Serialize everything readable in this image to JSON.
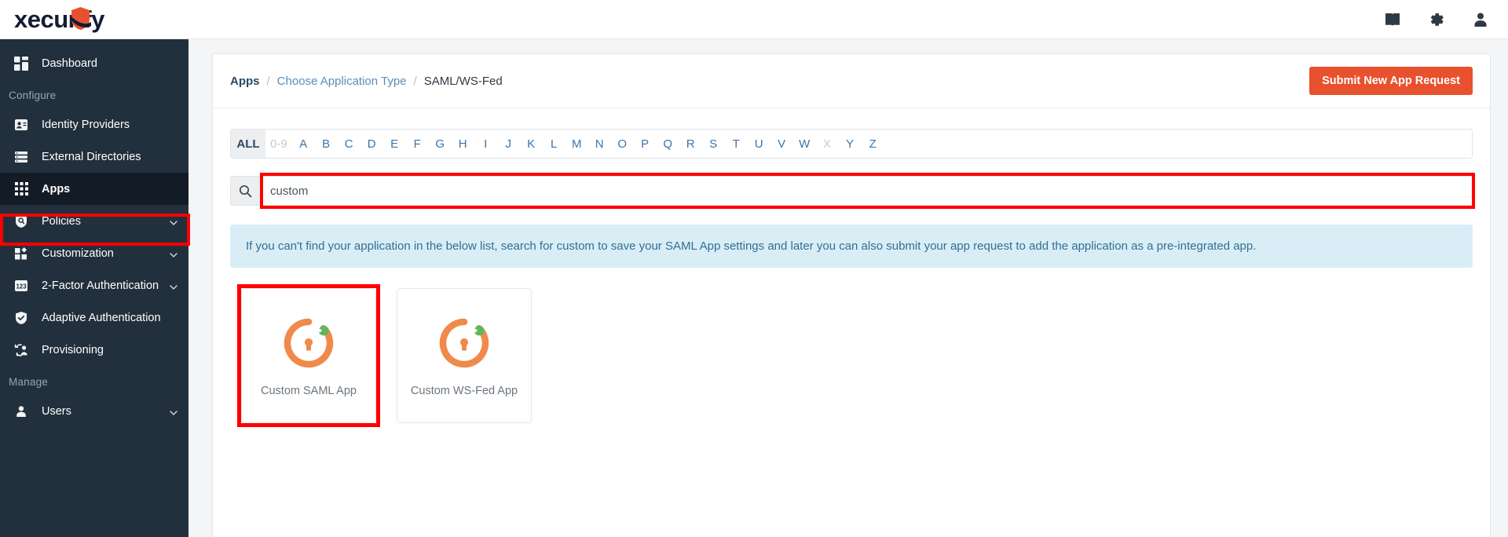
{
  "brand": {
    "logo_text": "xecurify",
    "accent_color": "#e8512d",
    "sidebar_color": "#22303d"
  },
  "topbar": {
    "icons": [
      {
        "name": "book-icon",
        "glyph": "book"
      },
      {
        "name": "gear-icon",
        "glyph": "gear"
      },
      {
        "name": "user-icon",
        "glyph": "user"
      }
    ]
  },
  "sidebar": {
    "dashboard": {
      "label": "Dashboard",
      "icon": "dashboard-icon"
    },
    "section_configure": "Configure",
    "section_manage": "Manage",
    "items": [
      {
        "label": "Identity Providers",
        "icon": "id-card-icon",
        "chevron": false,
        "active": false
      },
      {
        "label": "External Directories",
        "icon": "list-icon",
        "chevron": false,
        "active": false
      },
      {
        "label": "Apps",
        "icon": "grid-icon",
        "chevron": false,
        "active": true
      },
      {
        "label": "Policies",
        "icon": "policy-shield-icon",
        "chevron": true,
        "active": false
      },
      {
        "label": "Customization",
        "icon": "customization-icon",
        "chevron": true,
        "active": false
      },
      {
        "label": "2-Factor Authentication",
        "icon": "numbers-icon",
        "chevron": true,
        "active": false
      },
      {
        "label": "Adaptive Authentication",
        "icon": "check-shield-icon",
        "chevron": false,
        "active": false
      },
      {
        "label": "Provisioning",
        "icon": "provisioning-icon",
        "chevron": false,
        "active": false
      }
    ],
    "manage_items": [
      {
        "label": "Users",
        "icon": "person-icon",
        "chevron": true,
        "active": false
      }
    ]
  },
  "breadcrumb": {
    "root": "Apps",
    "sep": "/",
    "middle": "Choose Application Type",
    "last": "SAML/WS-Fed"
  },
  "header": {
    "submit_button": "Submit New App Request"
  },
  "alphabet": {
    "all": "ALL",
    "numeric": "0-9",
    "letters": [
      "A",
      "B",
      "C",
      "D",
      "E",
      "F",
      "G",
      "H",
      "I",
      "J",
      "K",
      "L",
      "M",
      "N",
      "O",
      "P",
      "Q",
      "R",
      "S",
      "T",
      "U",
      "V",
      "W",
      "X",
      "Y",
      "Z"
    ],
    "disabled_letters": [
      "X"
    ],
    "active": "ALL"
  },
  "search": {
    "value": "custom",
    "placeholder": "",
    "icon": "search-icon"
  },
  "banner": {
    "text": "If you can't find your application in the below list, search for custom to save your SAML App settings and later you can also submit your app request to add the application as a pre-integrated app.",
    "background": "#d9edf7",
    "text_color": "#31708f"
  },
  "apps": [
    {
      "label": "Custom SAML App",
      "icon": "custom-app-icon",
      "highlighted": true
    },
    {
      "label": "Custom WS-Fed App",
      "icon": "custom-app-icon",
      "highlighted": false
    }
  ]
}
